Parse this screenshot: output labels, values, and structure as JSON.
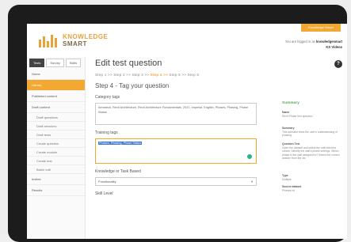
{
  "header": {
    "logo_line1": "KNOWLEDGE",
    "logo_line2": "SMART",
    "top_button": "Knowledge Smart",
    "logged_in_text": "You are logged in as",
    "user_name": "knowledgesmart",
    "sub_user": "KS Videos"
  },
  "sidebar": {
    "tabs": [
      "Tests",
      "Survey",
      "Skills"
    ],
    "items": [
      {
        "label": "Home",
        "type": "item"
      },
      {
        "label": "Library",
        "type": "hl"
      },
      {
        "label": "Published content",
        "type": "item"
      },
      {
        "label": "Draft content",
        "type": "item"
      },
      {
        "label": "Draft questions",
        "type": "sub"
      },
      {
        "label": "Draft sessions",
        "type": "sub"
      },
      {
        "label": "Draft tests",
        "type": "sub"
      },
      {
        "label": "Create question",
        "type": "sub"
      },
      {
        "label": "Create module",
        "type": "sub"
      },
      {
        "label": "Create test",
        "type": "sub"
      },
      {
        "label": "Batch edit",
        "type": "sub"
      },
      {
        "label": "Invites",
        "type": "item"
      },
      {
        "label": "Results",
        "type": "item"
      }
    ]
  },
  "main": {
    "page_title": "Edit test question",
    "steps": [
      "Step 1 >>",
      "Step 2 >>",
      "Step 3 >>",
      "Step 4 >>",
      "Step 5 >>",
      "Step 6"
    ],
    "current_step": 3,
    "step_heading": "Step 4 - Tag your question",
    "category_tags_label": "Category tags",
    "category_tags_value": "Aerodeck, Revit Architecture, Revit Architecture Fundamentals, 2021, Imperial, English, Phases, Phasing, Phase Status",
    "training_tags_label": "Training tags",
    "training_tags_value": "Phases, Phasing, Phase Status",
    "knowledge_label": "Knowledge or Task Based",
    "knowledge_value": "Functionality",
    "skill_label": "Skill Level"
  },
  "panel": {
    "help": "?",
    "summary_title": "Summary",
    "blocks": [
      {
        "title": "Name",
        "text": "Revit Phase test question"
      },
      {
        "title": "Summary",
        "text": "This question tests the user's understanding of phasing."
      },
      {
        "title": "Question Text",
        "text": "Open the dataset and select the wall element shown. Identify the wall's phase settings. Which phase is the wall assigned to? Select the correct answer from the list."
      },
      {
        "title": "Type",
        "text": "Multiple"
      },
      {
        "title": "Source dataset",
        "text": "Phases.rvt"
      }
    ]
  }
}
